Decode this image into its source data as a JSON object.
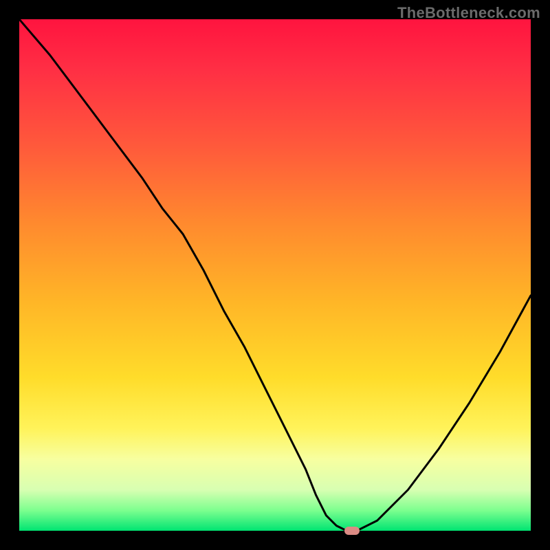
{
  "watermark": "TheBottleneck.com",
  "colors": {
    "frame": "#000000",
    "curve": "#000000",
    "marker": "#db8b84"
  },
  "chart_data": {
    "type": "line",
    "title": "",
    "xlabel": "",
    "ylabel": "",
    "xlim": [
      0,
      100
    ],
    "ylim": [
      0,
      100
    ],
    "note": "Values estimated from pixels on a 100×100 logical grid (0,0 bottom-left). Curve shows bottleneck mismatch; minimum ≈ x 63–66 at y ≈ 0.",
    "series": [
      {
        "name": "bottleneck-curve",
        "x": [
          0,
          6,
          12,
          18,
          24,
          28,
          32,
          36,
          40,
          44,
          48,
          52,
          56,
          58,
          60,
          62,
          64,
          66,
          70,
          76,
          82,
          88,
          94,
          100
        ],
        "y": [
          100,
          93,
          85,
          77,
          69,
          63,
          58,
          51,
          43,
          36,
          28,
          20,
          12,
          7,
          3,
          1,
          0,
          0,
          2,
          8,
          16,
          25,
          35,
          46
        ]
      }
    ],
    "marker": {
      "x": 65,
      "y": 0,
      "shape": "pill"
    },
    "gradient_stops": [
      {
        "p": 0,
        "c": "#ff143f"
      },
      {
        "p": 10,
        "c": "#ff2f44"
      },
      {
        "p": 25,
        "c": "#ff5a3b"
      },
      {
        "p": 40,
        "c": "#ff8a2e"
      },
      {
        "p": 55,
        "c": "#ffb527"
      },
      {
        "p": 70,
        "c": "#ffdc2a"
      },
      {
        "p": 80,
        "c": "#fff35a"
      },
      {
        "p": 86,
        "c": "#f7ffa0"
      },
      {
        "p": 92,
        "c": "#d8ffb2"
      },
      {
        "p": 96,
        "c": "#7dff8f"
      },
      {
        "p": 100,
        "c": "#00e472"
      }
    ]
  }
}
